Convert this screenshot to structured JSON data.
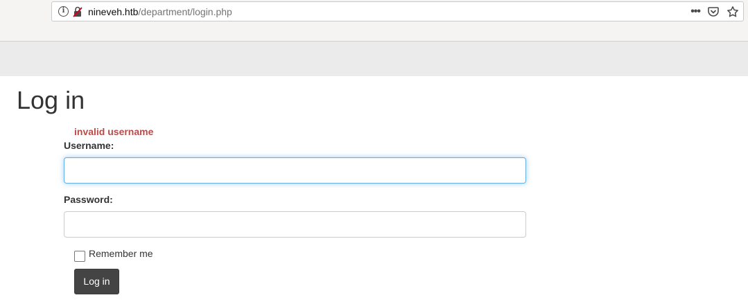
{
  "browser": {
    "url_host": "nineveh.htb",
    "url_path": "/department/login.php",
    "icons": [
      "info-icon",
      "insecure-lock-icon",
      "more-actions-icon",
      "pocket-icon",
      "bookmark-star-icon"
    ]
  },
  "page": {
    "title": "Log in",
    "error_message": "invalid username",
    "username_label": "Username:",
    "username_value": "",
    "password_label": "Password:",
    "password_value": "",
    "remember_label": "Remember me",
    "remember_checked": false,
    "submit_label": "Log in"
  },
  "colors": {
    "error": "#b94a48",
    "button_bg": "#444444",
    "focus_border": "#66afe9",
    "navbar_bg": "#ebebeb"
  }
}
